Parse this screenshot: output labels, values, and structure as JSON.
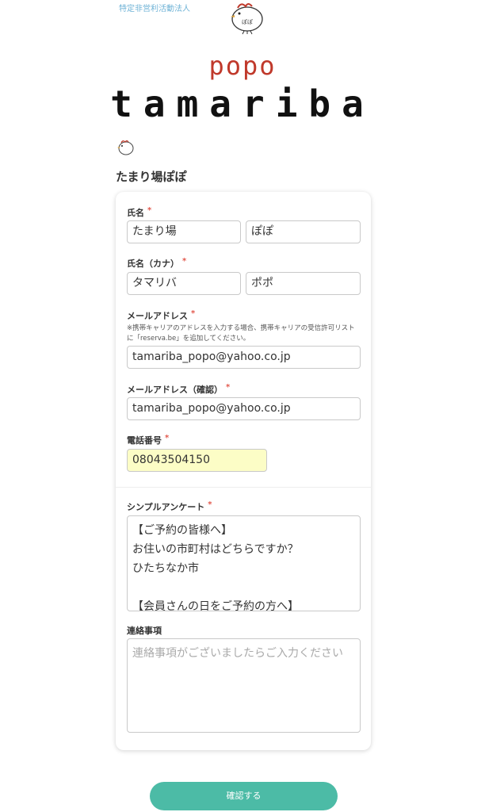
{
  "header": {
    "org_label": "特定非営利活動法人",
    "brand_small": "popo",
    "brand_large": "tamariba",
    "shop_title": "たまり場ぽぽ"
  },
  "form": {
    "name": {
      "label": "氏名",
      "required_mark": "*",
      "last": "たまり場",
      "first": "ぽぽ"
    },
    "name_kana": {
      "label": "氏名（カナ）",
      "required_mark": "*",
      "last": "タマリバ",
      "first": "ポポ"
    },
    "email": {
      "label": "メールアドレス",
      "required_mark": "*",
      "note": "※携帯キャリアのアドレスを入力する場合、携帯キャリアの受信許可リストに「reserva.be」を追加してください。",
      "value": "tamariba_popo@yahoo.co.jp"
    },
    "email_confirm": {
      "label": "メールアドレス（確認）",
      "required_mark": "*",
      "value": "tamariba_popo@yahoo.co.jp"
    },
    "phone": {
      "label": "電話番号",
      "required_mark": "*",
      "value": "08043504150"
    },
    "survey": {
      "label": "シンプルアンケート",
      "required_mark": "*",
      "lines": [
        "【ご予約の皆様へ】",
        "お住いの市町村はどちらですか？",
        "ひたちなか市",
        "",
        "【会員さんの日をご予約の方へ】"
      ]
    },
    "notes": {
      "label": "連絡事項",
      "placeholder": "連絡事項がございましたらご入力ください"
    }
  },
  "actions": {
    "confirm_label": "確認する"
  },
  "colors": {
    "accent": "#4cbba6",
    "required": "#e2574c",
    "brand_red": "#c0392b",
    "autofill": "#fcfdc6"
  }
}
